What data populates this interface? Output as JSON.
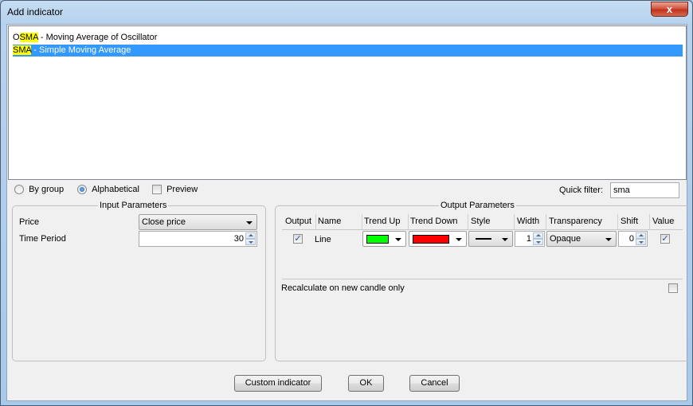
{
  "window": {
    "title": "Add indicator",
    "close_icon": "close-x-icon",
    "close_glyph": "x"
  },
  "indicator_list": {
    "items": [
      {
        "highlight_prefix": "O",
        "highlight": "SMA",
        "rest": " - Moving Average of Oscillator",
        "selected": false
      },
      {
        "highlight_prefix": "",
        "highlight": "SMA",
        "rest": " - Simple Moving Average",
        "selected": true
      }
    ]
  },
  "sort_options": {
    "by_group_label": "By group",
    "alphabetical_label": "Alphabetical",
    "selected": "Alphabetical",
    "preview_label": "Preview",
    "preview_checked": false
  },
  "quick_filter": {
    "label": "Quick filter:",
    "value": "sma"
  },
  "input_parameters": {
    "title": "Input Parameters",
    "price_label": "Price",
    "price_value": "Close price",
    "time_period_label": "Time Period",
    "time_period_value": "30"
  },
  "output_parameters": {
    "title": "Output Parameters",
    "columns": [
      "Output",
      "Name",
      "Trend Up",
      "Trend Down",
      "Style",
      "Width",
      "Transparency",
      "Shift",
      "Value"
    ],
    "rows": [
      {
        "output_checked": true,
        "name": "Line",
        "trend_up_color": "#00ff00",
        "trend_down_color": "#ff0000",
        "style": "solid-line",
        "width": "1",
        "transparency": "Opaque",
        "shift": "0",
        "value_checked": true
      }
    ],
    "recalculate_label": "Recalculate on new candle only",
    "recalculate_checked": false
  },
  "buttons": {
    "custom_indicator": "Custom indicator",
    "ok": "OK",
    "cancel": "Cancel"
  },
  "glyphs": {
    "check": "✓"
  }
}
